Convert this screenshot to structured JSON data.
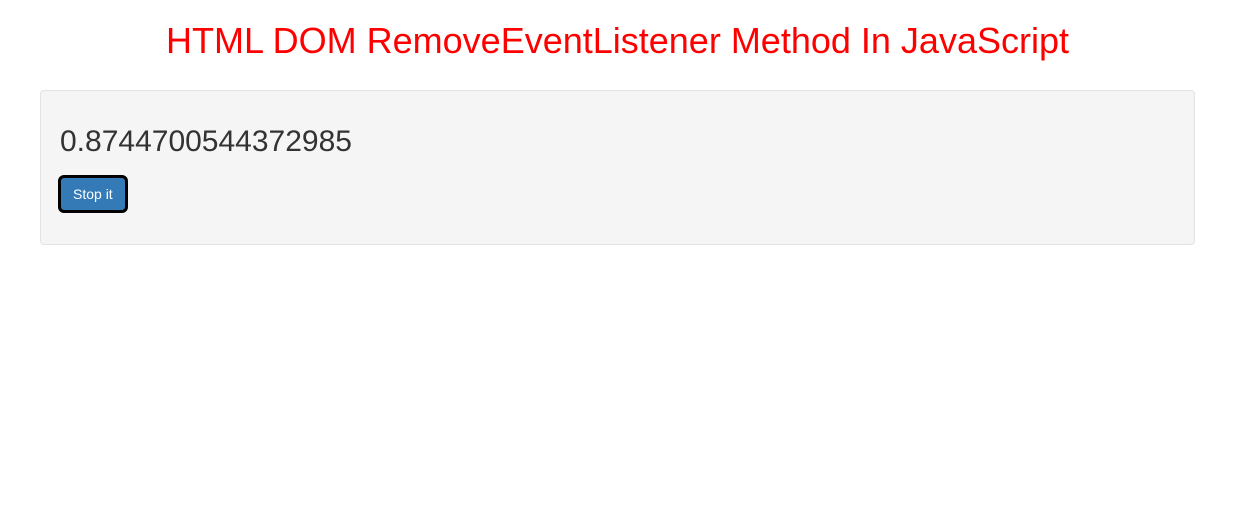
{
  "page": {
    "title": "HTML DOM RemoveEventListener Method In JavaScript"
  },
  "well": {
    "output_value": "0.8744700544372985",
    "button_label": "Stop it"
  }
}
